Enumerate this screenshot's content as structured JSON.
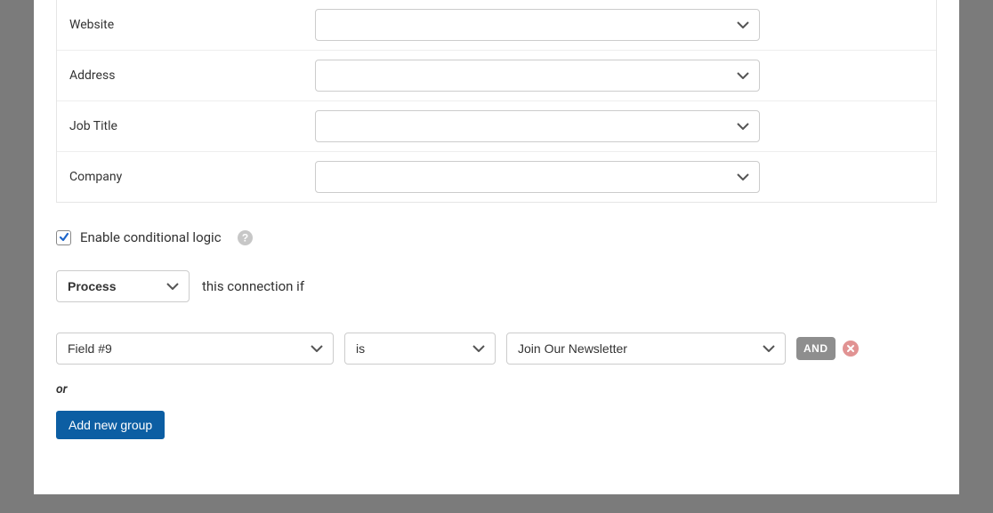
{
  "fields": [
    {
      "label": "Website",
      "value": ""
    },
    {
      "label": "Address",
      "value": ""
    },
    {
      "label": "Job Title",
      "value": ""
    },
    {
      "label": "Company",
      "value": ""
    }
  ],
  "conditional": {
    "checkbox_label": "Enable conditional logic",
    "checked": true,
    "process_value": "Process",
    "logic_text": "this connection if",
    "rule": {
      "field": "Field #9",
      "operator": "is",
      "value": "Join Our Newsletter"
    },
    "and_label": "AND",
    "or_label": "or",
    "add_group_label": "Add new group"
  }
}
